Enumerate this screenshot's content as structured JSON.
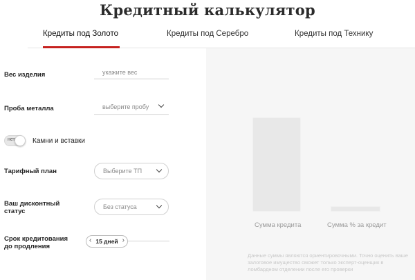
{
  "page": {
    "title": "Кредитный калькулятор"
  },
  "tabs": [
    {
      "label": "Кредиты под Золото",
      "active": true
    },
    {
      "label": "Кредиты под Серебро",
      "active": false
    },
    {
      "label": "Кредиты под Технику",
      "active": false
    }
  ],
  "form": {
    "weight": {
      "label": "Вес изделия",
      "placeholder": "укажите вес",
      "value": ""
    },
    "purity": {
      "label": "Проба металла",
      "value": "выберите пробу"
    },
    "stones": {
      "toggle_state": "нет",
      "label": "Камни и вставки",
      "on": false
    },
    "tariff": {
      "label": "Тарифный план",
      "value": "Выберите ТП"
    },
    "discount": {
      "label_line1": "Ваш дисконтный",
      "label_line2": "статус",
      "value": "Без статуса"
    },
    "term": {
      "label_line1": "Срок кредитования",
      "label_line2": "до продления",
      "value": "15 дней"
    }
  },
  "chart_data": {
    "type": "bar",
    "categories": [
      "Сумма кредита",
      "Сумма % за кредит"
    ],
    "values": [
      100,
      6
    ],
    "xlabel": "",
    "ylabel": ""
  },
  "note": "Данные суммы являются ориентировочными. Точно оценить ваше залоговое имущество сможет только эксперт-оценщик в ломбардном отделении после его проверки",
  "colors": {
    "accent": "#c6211f",
    "panel_bg": "#f6f6f6",
    "bar": "#e8e8e8"
  }
}
